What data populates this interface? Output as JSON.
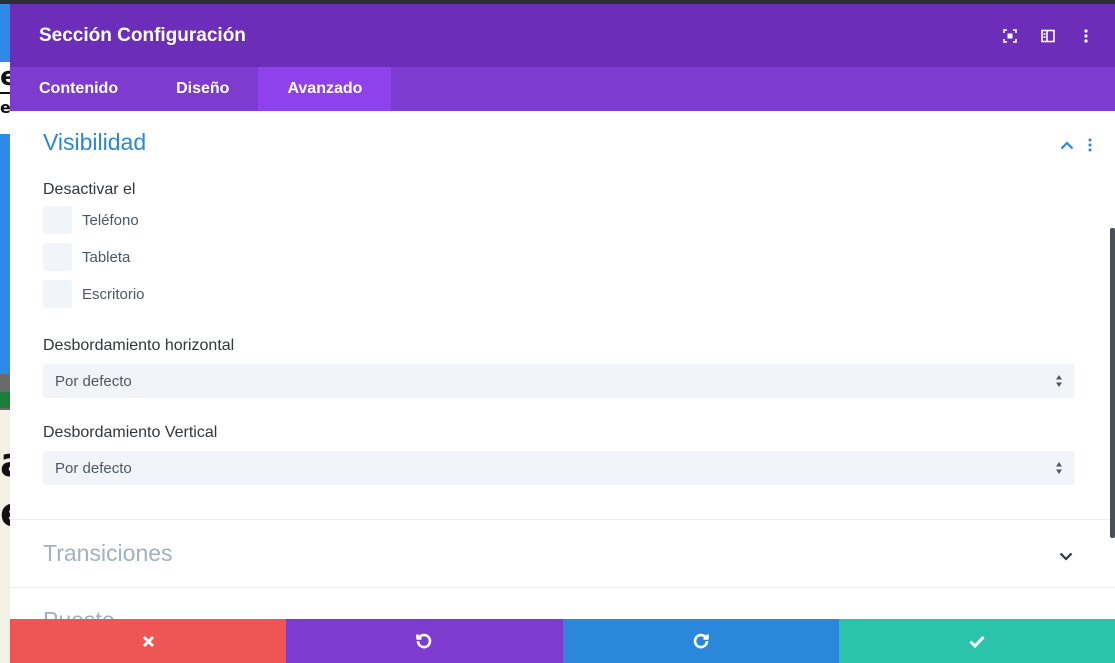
{
  "background_page": {
    "letters": [
      "e",
      "e",
      "á",
      "e"
    ]
  },
  "modal": {
    "title": "Sección Configuración",
    "header_icons": [
      "fullscreen-icon",
      "split-view-icon",
      "more-options-icon"
    ],
    "tabs": [
      {
        "label": "Contenido",
        "active": false
      },
      {
        "label": "Diseño",
        "active": false
      },
      {
        "label": "Avanzado",
        "active": true
      }
    ],
    "sections": {
      "visibility": {
        "title": "Visibilidad",
        "expanded": true,
        "disable_on_label": "Desactivar el",
        "checkboxes": [
          {
            "label": "Teléfono",
            "checked": false
          },
          {
            "label": "Tableta",
            "checked": false
          },
          {
            "label": "Escritorio",
            "checked": false
          }
        ],
        "overflow_x": {
          "label": "Desbordamiento horizontal",
          "value": "Por defecto"
        },
        "overflow_y": {
          "label": "Desbordamiento Vertical",
          "value": "Por defecto"
        }
      },
      "transitions": {
        "title": "Transiciones",
        "expanded": false
      },
      "position": {
        "title": "Puesto",
        "expanded": false
      }
    },
    "footer_buttons": [
      {
        "name": "cancel",
        "icon": "close-icon",
        "color": "#ef5555"
      },
      {
        "name": "undo",
        "icon": "undo-icon",
        "color": "#7e3bd0"
      },
      {
        "name": "redo",
        "icon": "redo-icon",
        "color": "#2b87da"
      },
      {
        "name": "save",
        "icon": "check-icon",
        "color": "#29c4a9"
      }
    ]
  },
  "colors": {
    "header": "#6c2eb9",
    "tabs": "#7e3bd0",
    "active_tab": "#8f42ec",
    "accent_blue": "#2b87da"
  }
}
